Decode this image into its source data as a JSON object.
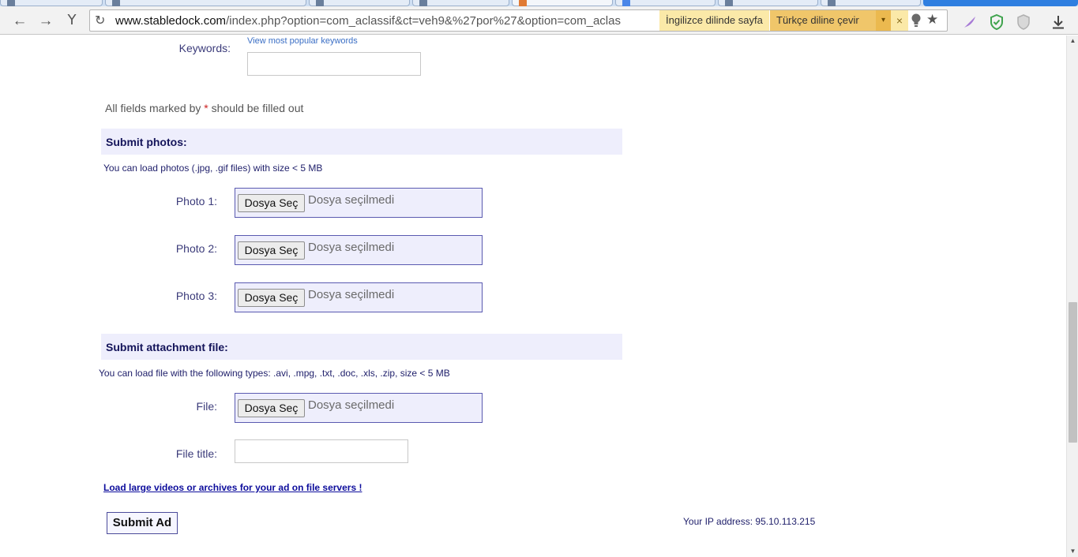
{
  "browser": {
    "url_host": "www.stabledock.com",
    "url_path": "/index.php?option=com_aclassif&ct=veh9&%27por%27&option=com_aclas",
    "translate_prompt": "İngilizce dilinde sayfa",
    "translate_button": "Türkçe diline çevir",
    "translate_close": "×",
    "dropdown_glyph": "▾"
  },
  "form": {
    "keywords_label": "Keywords:",
    "popular_keywords_link": "View most popular keywords",
    "keywords_value": "",
    "required_note_before": "All fields marked by ",
    "required_star": "*",
    "required_note_after": " should be filled out"
  },
  "photos": {
    "section_title": "Submit photos:",
    "note": "You can load photos (.jpg, .gif files) with size < 5 MB",
    "items": [
      {
        "label": "Photo 1:",
        "button": "Dosya Seç",
        "status": "Dosya seçilmedi"
      },
      {
        "label": "Photo 2:",
        "button": "Dosya Seç",
        "status": "Dosya seçilmedi"
      },
      {
        "label": "Photo 3:",
        "button": "Dosya Seç",
        "status": "Dosya seçilmedi"
      }
    ]
  },
  "attachment": {
    "section_title": "Submit attachment file:",
    "note": "You can load file with the following types: .avi, .mpg, .txt, .doc, .xls, .zip, size < 5 MB",
    "file_label": "File:",
    "file_button": "Dosya Seç",
    "file_status": "Dosya seçilmedi",
    "title_label": "File title:",
    "title_value": ""
  },
  "footer": {
    "large_files_link": "Load large videos or archives for your ad on file servers !",
    "submit_label": "Submit Ad",
    "ip_text": "Your IP address: 95.10.113.215"
  },
  "colors": {
    "section_bg": "#eeeefc",
    "border_blue": "#5a5ab0",
    "link_blue": "#0d0d9c"
  }
}
